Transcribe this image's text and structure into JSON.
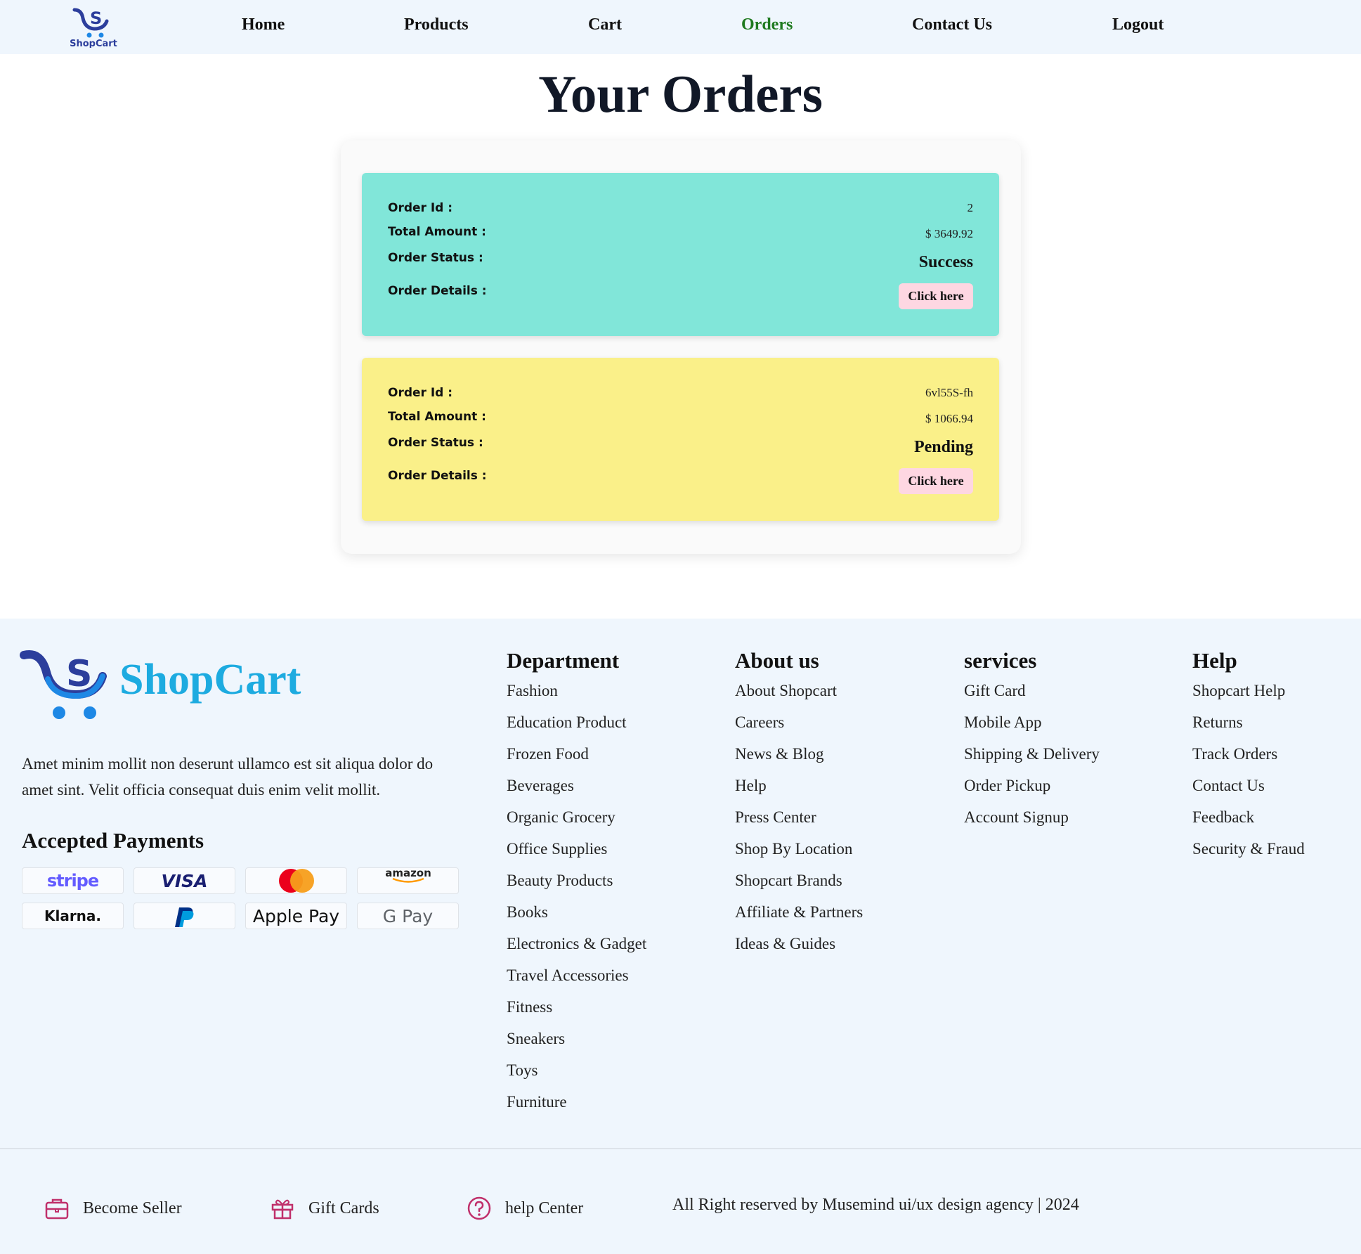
{
  "nav": {
    "logo_text": "ShopCart",
    "links": [
      "Home",
      "Products",
      "Cart",
      "Orders",
      "Contact Us",
      "Logout"
    ],
    "active": "Orders"
  },
  "page": {
    "title": "Your Orders"
  },
  "orders": [
    {
      "id_label": "Order Id :",
      "id": "2",
      "amount_label": "Total Amount :",
      "amount": "$ 3649.92",
      "status_label": "Order Status :",
      "status": "Success",
      "details_label": "Order Details :",
      "details_button": "Click here",
      "color": "#81e6d9"
    },
    {
      "id_label": "Order Id :",
      "id": "6vl55S-fh",
      "amount_label": "Total Amount :",
      "amount": "$ 1066.94",
      "status_label": "Order Status :",
      "status": "Pending",
      "details_label": "Order Details :",
      "details_button": "Click here",
      "color": "#faf089"
    }
  ],
  "footer": {
    "brand": "ShopCart",
    "description": "Amet minim mollit non deserunt ullamco est sit aliqua dolor do amet sint. Velit officia consequat duis enim velit mollit.",
    "payments_title": "Accepted Payments",
    "payments": [
      "stripe",
      "VISA",
      "Mastercard",
      "amazon",
      "Klarna.",
      "PayPal",
      "Apple Pay",
      "G Pay"
    ],
    "columns": [
      {
        "title": "Department",
        "items": [
          "Fashion",
          "Education Product",
          "Frozen Food",
          "Beverages",
          "Organic Grocery",
          "Office Supplies",
          "Beauty Products",
          "Books",
          "Electronics & Gadget",
          "Travel Accessories",
          "Fitness",
          "Sneakers",
          "Toys",
          "Furniture"
        ]
      },
      {
        "title": "About us",
        "items": [
          "About Shopcart",
          "Careers",
          "News & Blog",
          "Help",
          "Press Center",
          "Shop By Location",
          "Shopcart Brands",
          "Affiliate & Partners",
          "Ideas & Guides"
        ]
      },
      {
        "title": "services",
        "items": [
          "Gift Card",
          "Mobile App",
          "Shipping & Delivery",
          "Order Pickup",
          "Account Signup"
        ]
      },
      {
        "title": "Help",
        "items": [
          "Shopcart Help",
          "Returns",
          "Track Orders",
          "Contact Us",
          "Feedback",
          "Security & Fraud"
        ]
      }
    ],
    "bottom": {
      "become_seller": "Become Seller",
      "gift_cards": "Gift Cards",
      "help_center": "help Center",
      "copyright": "All Right reserved by Musemind ui/ux design agency | 2024"
    },
    "icon_color": "#c0306b"
  }
}
